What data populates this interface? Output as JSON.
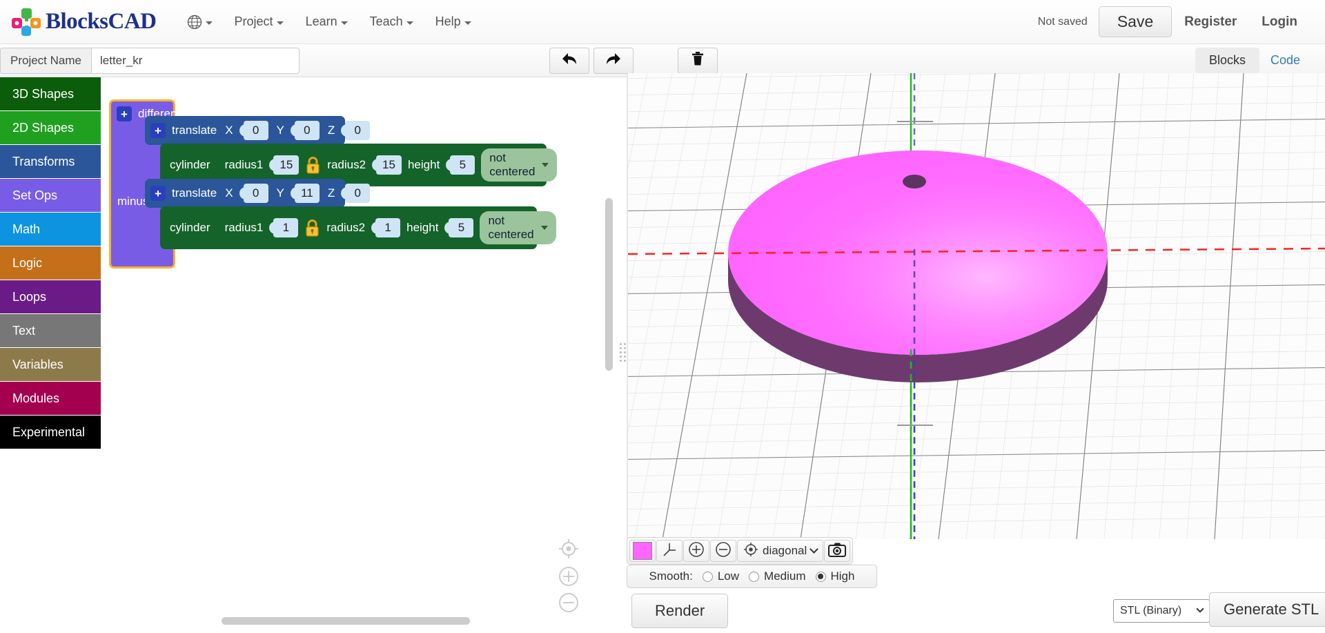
{
  "navbar": {
    "brand_name": "BlocksCAD",
    "logo_icon": "blockscad-logo-icon",
    "globe_icon": "globe-icon",
    "menus": [
      {
        "label": "Project"
      },
      {
        "label": "Learn"
      },
      {
        "label": "Teach"
      },
      {
        "label": "Help"
      }
    ],
    "save_status": "Not saved",
    "save_label": "Save",
    "register_label": "Register",
    "login_label": "Login"
  },
  "subbar": {
    "project_name_label": "Project Name",
    "project_name_value": "letter_kr",
    "project_name_placeholder": "Project Name",
    "undo_icon": "undo-icon",
    "redo_icon": "redo-icon",
    "trash_icon": "trash-icon",
    "blocks_tab": "Blocks",
    "code_tab": "Code"
  },
  "sidebar": {
    "items": [
      {
        "label": "3D Shapes",
        "color": "#0b5c0b"
      },
      {
        "label": "2D Shapes",
        "color": "#1fa01f"
      },
      {
        "label": "Transforms",
        "color": "#2b5699"
      },
      {
        "label": "Set Ops",
        "color": "#795ce6"
      },
      {
        "label": "Math",
        "color": "#0d94e0"
      },
      {
        "label": "Logic",
        "color": "#c4701a"
      },
      {
        "label": "Loops",
        "color": "#6a1b86"
      },
      {
        "label": "Text",
        "color": "#777777"
      },
      {
        "label": "Variables",
        "color": "#8d7a4a"
      },
      {
        "label": "Modules",
        "color": "#a30050"
      },
      {
        "label": "Experimental",
        "color": "#000000"
      }
    ]
  },
  "workspace": {
    "difference_block": {
      "label": "difference",
      "minus_label": "minus",
      "expand_icon": "plus-icon",
      "color": "#795ce6",
      "selected_outline": "#f7b32b"
    },
    "translate_1": {
      "label": "translate",
      "expand_icon": "plus-icon",
      "color": "#2b5699",
      "fields": [
        {
          "axis": "X",
          "value": "0"
        },
        {
          "axis": "Y",
          "value": "0"
        },
        {
          "axis": "Z",
          "value": "0"
        }
      ]
    },
    "cylinder_1": {
      "label": "cylinder",
      "color": "#14632b",
      "lock_icon": "lock-icon",
      "radius1_label": "radius1",
      "radius1_value": "15",
      "radius2_label": "radius2",
      "radius2_value": "15",
      "height_label": "height",
      "height_value": "5",
      "centering": "not centered"
    },
    "translate_2": {
      "label": "translate",
      "expand_icon": "plus-icon",
      "color": "#2b5699",
      "fields": [
        {
          "axis": "X",
          "value": "0"
        },
        {
          "axis": "Y",
          "value": "11"
        },
        {
          "axis": "Z",
          "value": "0"
        }
      ]
    },
    "cylinder_2": {
      "label": "cylinder",
      "color": "#14632b",
      "lock_icon": "lock-icon",
      "radius1_label": "radius1",
      "radius1_value": "1",
      "radius2_label": "radius2",
      "radius2_value": "1",
      "height_label": "height",
      "height_value": "5",
      "centering": "not centered"
    },
    "controls": {
      "center_icon": "center-target-icon",
      "zoom_in_icon": "zoom-in-icon",
      "zoom_out_icon": "zoom-out-icon"
    }
  },
  "viewer": {
    "object_color": "#ff66ff",
    "object_side_color": "#6e3a6e",
    "x_axis_color": "#ff2020",
    "y_axis_color": "#18c018",
    "z_axis_color": "#3b3bbb",
    "toolbar": {
      "color_swatch_icon": "color-swatch-icon",
      "axes_icon": "axes-icon",
      "zoom_in_icon": "zoom-in-icon",
      "zoom_out_icon": "zoom-out-icon",
      "view_target_icon": "view-target-icon",
      "view_mode": "diagonal",
      "camera_icon": "camera-icon"
    },
    "smooth": {
      "label": "Smooth:",
      "options": [
        {
          "label": "Low",
          "selected": false
        },
        {
          "label": "Medium",
          "selected": false
        },
        {
          "label": "High",
          "selected": true
        }
      ]
    },
    "render_label": "Render",
    "stl_format": "STL (Binary)",
    "generate_stl_label": "Generate STL"
  }
}
